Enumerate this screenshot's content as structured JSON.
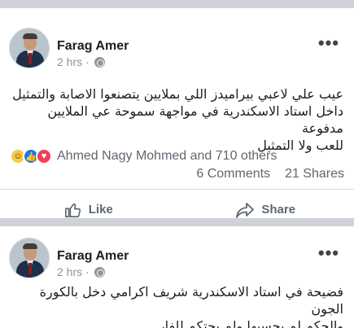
{
  "posts": [
    {
      "author": "Farag Amer",
      "time": "2 hrs · ",
      "more_icon": "•••",
      "text_line1": "عيب علي لاعبي بيراميدز اللي بملايين يتصنعوا الاصابة والتمثيل",
      "text_line2": "داخل استاد الاسكندرية في مواجهة سموحة عي الملايين مدفوعة",
      "text_line3": "للعب ولا التمثيل",
      "reactors": "Ahmed Nagy Mohmed and 710 others",
      "comments": "6 Comments",
      "shares": "21 Shares",
      "like_label": "Like",
      "share_label": "Share",
      "reaction_icons": [
        "haha-icon",
        "like-icon",
        "love-icon"
      ]
    },
    {
      "author": "Farag Amer",
      "time": "2 hrs · ",
      "more_icon": "•••",
      "text_line1": "فضيحة في استاد الاسكندرية شريف اكرامي دخل بالكورة الجون",
      "text_line2": "والحكم لم يحسبها ولم يحتكم للفار"
    }
  ],
  "colors": {
    "background": "#e9ebee",
    "separator": "#cfd2d6",
    "meta": "#90949c",
    "like_blue": "#1877f2",
    "love_red": "#f33e58",
    "haha_yellow": "#f7c843"
  }
}
